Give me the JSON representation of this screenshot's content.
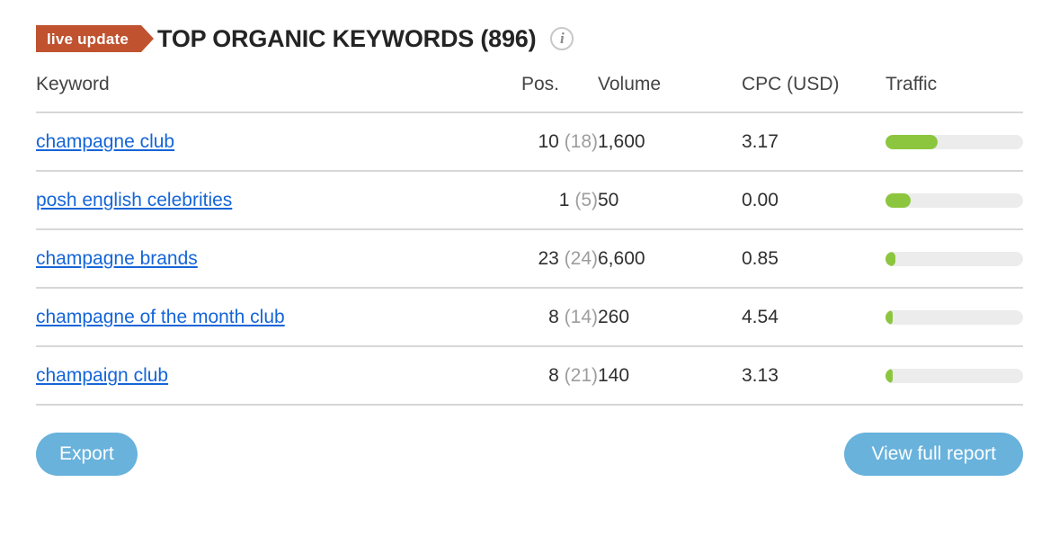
{
  "header": {
    "badge_label": "live update",
    "title": "TOP ORGANIC KEYWORDS (896)",
    "info_icon_glyph": "i",
    "badge_color": "#c0522f",
    "title_color": "#242424"
  },
  "table": {
    "columns": [
      "Keyword",
      "Pos.",
      "Volume",
      "CPC (USD)",
      "Traffic"
    ],
    "rows": [
      {
        "keyword": "champagne club",
        "pos_current": "10",
        "pos_previous": "(18)",
        "volume": "1,600",
        "cpc": "3.17",
        "traffic_percent": 38
      },
      {
        "keyword": "posh english celebrities",
        "pos_current": "1",
        "pos_previous": "(5)",
        "volume": "50",
        "cpc": "0.00",
        "traffic_percent": 18
      },
      {
        "keyword": "champagne brands",
        "pos_current": "23",
        "pos_previous": "(24)",
        "volume": "6,600",
        "cpc": "0.85",
        "traffic_percent": 7
      },
      {
        "keyword": "champagne of the month club",
        "pos_current": "8",
        "pos_previous": "(14)",
        "volume": "260",
        "cpc": "4.54",
        "traffic_percent": 5
      },
      {
        "keyword": "champaign club",
        "pos_current": "8",
        "pos_previous": "(21)",
        "volume": "140",
        "cpc": "3.13",
        "traffic_percent": 3.5
      }
    ],
    "bar_fill_color": "#8cc63e",
    "bar_track_color": "#ececec"
  },
  "footer": {
    "export_label": "Export",
    "view_full_report_label": "View full report",
    "button_color": "#68b2dc"
  }
}
